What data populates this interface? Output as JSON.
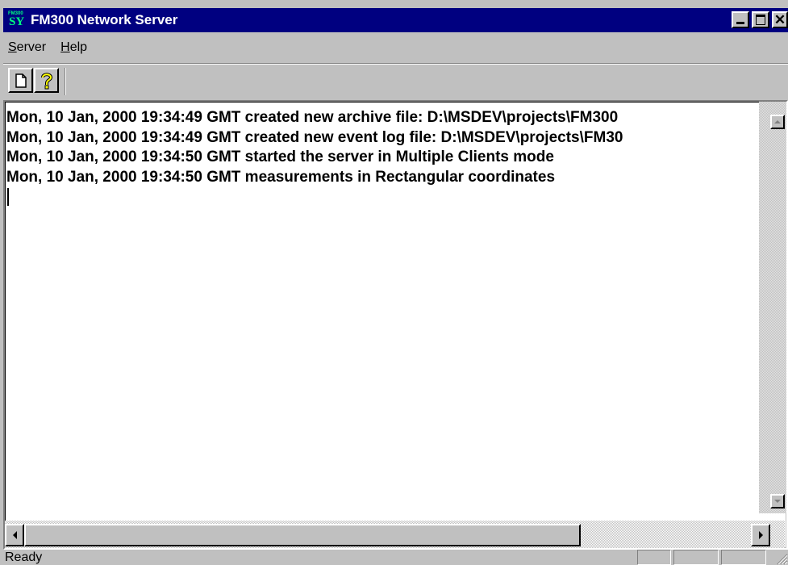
{
  "window": {
    "title": "FM300 Network Server",
    "icon_name": "fm300-app-icon",
    "icon_text_small": "FM300",
    "icon_text_large": "SY"
  },
  "menu": [
    {
      "label": "Server"
    },
    {
      "label": "Help"
    }
  ],
  "toolbar": [
    {
      "icon": "new-document-icon"
    },
    {
      "icon": "help-question-icon"
    }
  ],
  "log": [
    "Mon, 10 Jan, 2000 19:34:49 GMT created new archive file: D:\\MSDEV\\projects\\FM300",
    "Mon, 10 Jan, 2000 19:34:49 GMT created new event log file: D:\\MSDEV\\projects\\FM30",
    "Mon, 10 Jan, 2000 19:34:50 GMT started the server in Multiple Clients mode",
    "Mon, 10 Jan, 2000 19:34:50 GMT measurements in Rectangular coordinates"
  ],
  "status": {
    "text": "Ready"
  },
  "colors": {
    "titlebar": "#000080",
    "face": "#c0c0c0",
    "client": "#ffffff"
  }
}
